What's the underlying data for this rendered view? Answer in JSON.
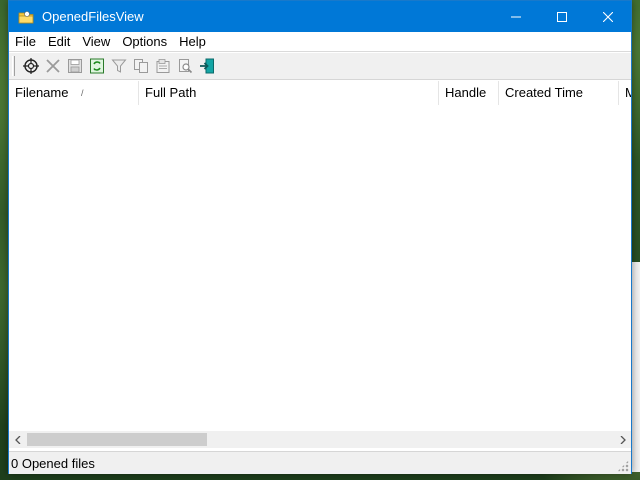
{
  "window": {
    "title": "OpenedFilesView",
    "controls": {
      "minimize": "minimize",
      "maximize": "maximize",
      "close": "close"
    }
  },
  "menu": [
    "File",
    "Edit",
    "View",
    "Options",
    "Help"
  ],
  "toolbar": {
    "buttons": [
      {
        "name": "target-icon",
        "enabled": true
      },
      {
        "name": "close-handle-icon",
        "enabled": false
      },
      {
        "name": "save-icon",
        "enabled": false
      },
      {
        "name": "refresh-icon",
        "enabled": true
      },
      {
        "name": "filter-icon",
        "enabled": false
      },
      {
        "name": "copy-icon",
        "enabled": false
      },
      {
        "name": "properties-icon",
        "enabled": false
      },
      {
        "name": "find-icon",
        "enabled": false
      },
      {
        "name": "exit-icon",
        "enabled": true
      }
    ]
  },
  "columns": [
    {
      "label": "Filename",
      "sorted": true
    },
    {
      "label": "Full Path"
    },
    {
      "label": "Handle"
    },
    {
      "label": "Created Time"
    },
    {
      "label": "M"
    }
  ],
  "rows": [],
  "status": {
    "text": "0 Opened files"
  },
  "colors": {
    "titlebar": "#0078d7",
    "chrome": "#f0f0f0"
  }
}
